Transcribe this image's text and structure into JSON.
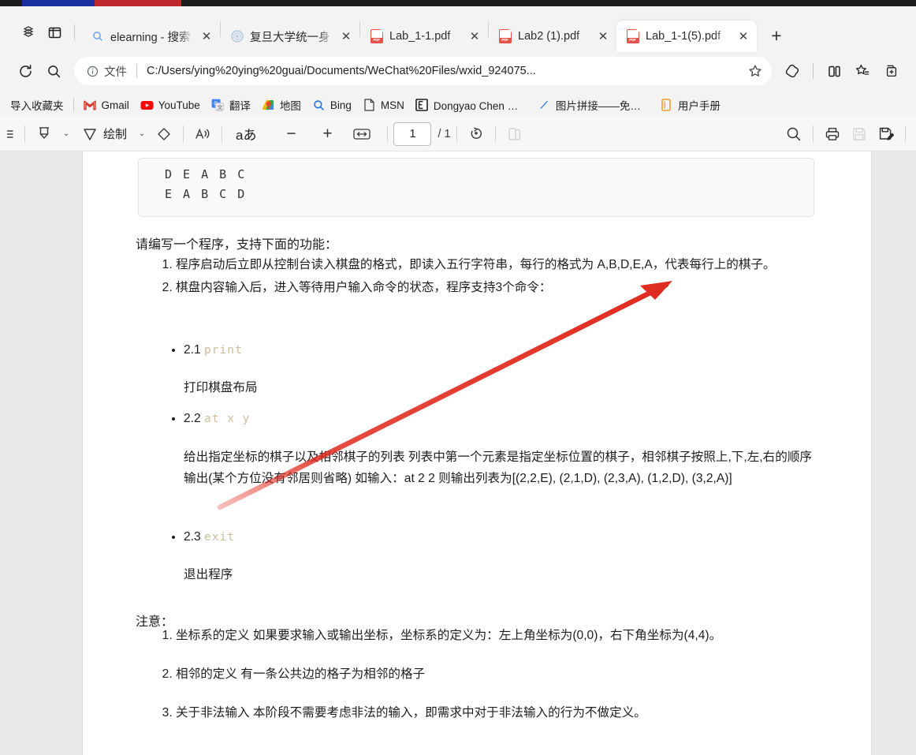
{
  "os_strip": {
    "accent_blue": "#1b2f9e",
    "accent_red": "#c0272d"
  },
  "browser": {
    "left_buttons": [
      {
        "name": "collections-icon",
        "label": ""
      },
      {
        "name": "split-screen-icon",
        "label": ""
      }
    ],
    "tabs": [
      {
        "title": "elearning - 搜索",
        "favicon": "search-icon",
        "active": false
      },
      {
        "title": "复旦大学统一身",
        "favicon": "fudan-icon",
        "active": false
      },
      {
        "title": "Lab_1-1.pdf",
        "favicon": "pdf-icon",
        "active": false
      },
      {
        "title": "Lab2 (1).pdf",
        "favicon": "pdf-icon",
        "active": false
      },
      {
        "title": "Lab_1-1(5).pdf",
        "favicon": "pdf-icon",
        "active": true
      }
    ],
    "close_glyph": "✕",
    "new_tab_glyph": "+",
    "address": {
      "scheme_label": "文件",
      "url": "C:/Users/ying%20ying%20guai/Documents/WeChat%20Files/wxid_924075...",
      "info_icon": "info-icon",
      "star_icon": "star-icon"
    },
    "toolbar_right_icons": [
      "browser-essentials-icon",
      "split-screen-icon",
      "favorites-icon",
      "collections-add-icon"
    ],
    "bookmarks": [
      {
        "label": "导入收藏夹",
        "icon": "import-favorites-icon"
      },
      {
        "label": "Gmail",
        "icon": "gmail-icon"
      },
      {
        "label": "YouTube",
        "icon": "youtube-icon"
      },
      {
        "label": "翻译",
        "icon": "google-translate-icon"
      },
      {
        "label": "地图",
        "icon": "google-maps-icon"
      },
      {
        "label": "Bing",
        "icon": "bing-icon"
      },
      {
        "label": "MSN",
        "icon": "msn-icon"
      },
      {
        "label": "Dongyao Chen 陈...",
        "icon": "page-icon"
      },
      {
        "label": "图片拼接——免费...",
        "icon": "blue-slash-icon"
      },
      {
        "label": "用户手册",
        "icon": "orange-book-icon"
      }
    ]
  },
  "pdf_toolbar": {
    "menu_icon": "hamburger-icon",
    "highlight_icon": "highlighter-icon",
    "highlight_caret": "⌄",
    "draw_icon": "pen-icon",
    "draw_label": "绘制",
    "draw_caret": "⌄",
    "erase_icon": "eraser-icon",
    "read_aloud_icon": "read-aloud-icon",
    "text_size_label": "aあ",
    "zoom_out_glyph": "−",
    "zoom_in_glyph": "+",
    "fit_width_icon": "fit-width-icon",
    "page_number": "1",
    "page_total": "/ 1",
    "rotate_icon": "rotate-icon",
    "page_view_icon": "page-view-icon",
    "search_icon": "search-icon",
    "print_icon": "print-icon",
    "save_icon": "save-icon",
    "save_as_icon": "save-as-icon"
  },
  "document": {
    "code_block_lines": [
      "D E A B C",
      "E A B C D"
    ],
    "intro": "请编写一个程序，支持下面的功能：",
    "main_items": [
      "程序启动后立即从控制台读入棋盘的格式，即读入五行字符串，每行的格式为 A,B,D,E,A，代表每行上的棋子。",
      "棋盘内容输入后，进入等待用户输入命令的状态，程序支持3个命令："
    ],
    "commands": [
      {
        "number": "2.1",
        "code": "print",
        "body": "打印棋盘布局"
      },
      {
        "number": "2.2",
        "code": "at x y",
        "body": "给出指定坐标的棋子以及相邻棋子的列表 列表中第一个元素是指定坐标位置的棋子，相邻棋子按照上,下,左,右的顺序输出(某个方位没有邻居则省略) 如输入：at 2 2 则输出列表为[(2,2,E), (2,1,D), (2,3,A), (1,2,D), (3,2,A)]"
      },
      {
        "number": "2.3",
        "code": "exit",
        "body": "退出程序"
      }
    ],
    "notes_heading": "注意：",
    "notes": [
      "坐标系的定义 如果要求输入或输出坐标，坐标系的定义为：左上角坐标为(0,0)，右下角坐标为(4,4)。",
      "相邻的定义 有一条公共边的格子为相邻的格子",
      "关于非法输入 本阶段不需要考虑非法的输入，即需求中对于非法输入的行为不做定义。"
    ],
    "annotation": {
      "type": "red-arrow",
      "color": "#e02b20"
    }
  }
}
